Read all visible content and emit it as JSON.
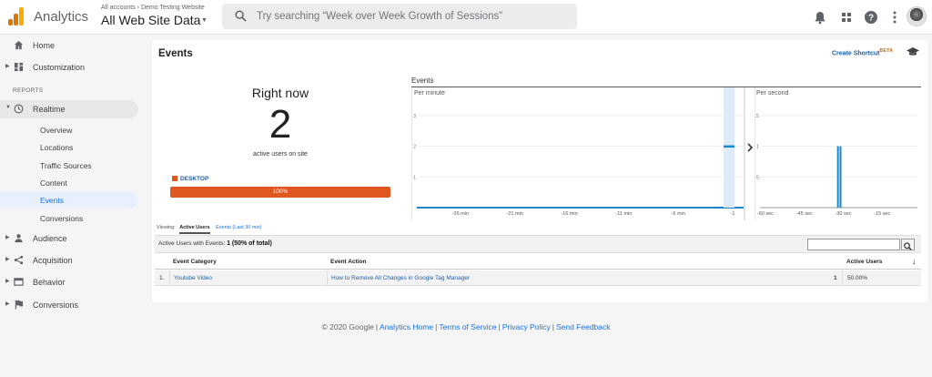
{
  "header": {
    "brand": "Analytics",
    "account_path": "All accounts › Demo Testing Website",
    "account_name": "All Web Site Data",
    "search_placeholder": "Try searching “Week over Week Growth of Sessions”",
    "logo_colors": [
      "#f9ab00",
      "#e37400",
      "#e37400"
    ]
  },
  "sidebar": {
    "home": "Home",
    "customization": "Customization",
    "section_reports": "REPORTS",
    "realtime": "Realtime",
    "realtime_items": [
      "Overview",
      "Locations",
      "Traffic Sources",
      "Content",
      "Events",
      "Conversions"
    ],
    "active_item": "Events",
    "audience": "Audience",
    "acquisition": "Acquisition",
    "behavior": "Behavior",
    "conversions": "Conversions"
  },
  "main": {
    "title": "Events",
    "create_shortcut": "Create Shortcut",
    "beta": "BETA",
    "right_now": {
      "title": "Right now",
      "count": "2",
      "subtitle": "active users on site",
      "device_label": "DESKTOP",
      "device_percent": "100%",
      "device_fraction": 1.0
    },
    "events_chart_label": "Events",
    "tabs": {
      "viewing": "Viewing:",
      "active": "Active Users",
      "other": "Events (Last 30 min)"
    },
    "summary": {
      "label": "Active Users with Events:",
      "value": "1",
      "pct": "(50% of total)"
    },
    "table": {
      "headers": [
        "Event Category",
        "Event Action",
        "Active Users"
      ],
      "rows": [
        {
          "index": "1.",
          "category": "Youtube Video",
          "action": "How to Remove All Changes in Google Tag Manager",
          "count": "1",
          "pct": "50.00%"
        }
      ]
    }
  },
  "chart_data": [
    {
      "type": "bar",
      "title": "Per minute",
      "x_ticks": [
        "-26 min",
        "-21 min",
        "-16 min",
        "-11 min",
        "-6 min",
        "-1"
      ],
      "y_ticks": [
        "1",
        "2",
        "3"
      ],
      "ylim": [
        0,
        3.5
      ],
      "x": [
        -1
      ],
      "values": [
        2
      ],
      "color": "#1a87c8"
    },
    {
      "type": "bar",
      "title": "Per second",
      "x_ticks": [
        "-60 sec",
        "-45 sec",
        "-30 sec",
        "-15 sec"
      ],
      "y_ticks": [
        "0.5",
        "1",
        "1.5"
      ],
      "ylim": [
        0,
        1.75
      ],
      "x": [
        -31,
        -30
      ],
      "values": [
        1,
        1
      ],
      "color": "#1a87c8"
    }
  ],
  "footer": {
    "copyright": "© 2020 Google",
    "links": [
      "Analytics Home",
      "Terms of Service",
      "Privacy Policy",
      "Send Feedback"
    ]
  }
}
